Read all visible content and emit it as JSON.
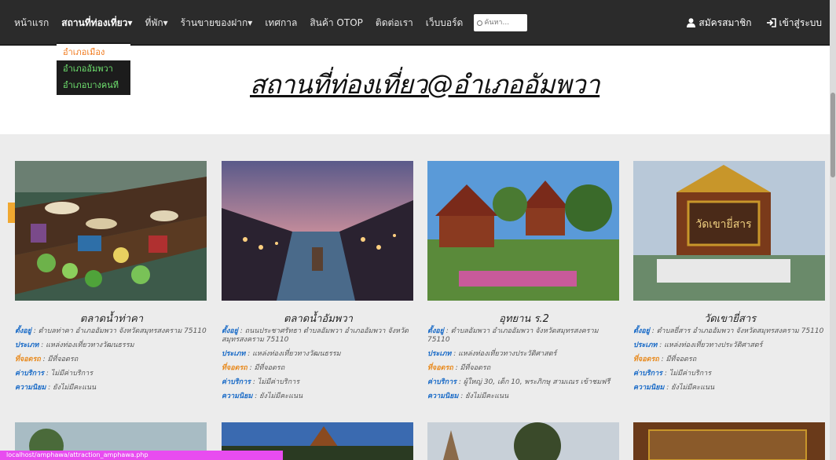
{
  "nav": {
    "items": [
      "หน้าแรก",
      "สถานที่ท่องเที่ยว▾",
      "ที่พัก▾",
      "ร้านขายของฝาก▾",
      "เทศกาล",
      "สินค้า OTOP",
      "ติดต่อเรา",
      "เว็บบอร์ด"
    ],
    "search_placeholder": "ค้นหา..."
  },
  "right_nav": {
    "register": "สมัครสมาชิก",
    "login": "เข้าสู่ระบบ"
  },
  "dropdown": [
    "อำเภอเมือง",
    "อำเภออัมพวา",
    "อำเภอบางคนที"
  ],
  "hero": {
    "title": "สถานที่ท่องเที่ยว@อำเภออัมพวา"
  },
  "info_icon": "i",
  "labels": {
    "address": "ตั้งอยู่",
    "type": "ประเภท",
    "contact": "ที่จอดรถ",
    "fee": "ค่าบริการ",
    "popularity": "ความนิยม"
  },
  "cards": [
    {
      "title": "ตลาดน้ำท่าคา",
      "address": " : ตำบลท่าคา อำเภออัมพวา จังหวัดสมุทรสงคราม 75110",
      "type": " : แหล่งท่องเที่ยวทางวัฒนธรรม",
      "contact": " : มีที่จอดรถ",
      "fee": " : ไม่มีค่าบริการ",
      "popularity": " : ยังไม่มีคะแนน"
    },
    {
      "title": "ตลาดน้ำอัมพวา",
      "address": " : ถนนประชาศรัทธา ตำบลอัมพวา อำเภออัมพวา จังหวัดสมุทรสงคราม 75110",
      "type": " : แหล่งท่องเที่ยวทางวัฒนธรรม",
      "contact": " : มีที่จอดรถ",
      "fee": " : ไม่มีค่าบริการ",
      "popularity": " : ยังไม่มีคะแนน"
    },
    {
      "title": "อุทยาน ร.2",
      "address": " : ตำบลอัมพวา อำเภออัมพวา จังหวัดสมุทรสงคราม 75110",
      "type": " : แหล่งท่องเที่ยวทางประวัติศาสตร์",
      "contact": " : มีที่จอดรถ",
      "fee": " : ผู้ใหญ่ 30, เด็ก 10, พระภิกษุ สามเณร เข้าชมฟรี",
      "popularity": " : ยังไม่มีคะแนน"
    },
    {
      "title": "วัดเขายี่สาร",
      "address": " : ตำบลยี่สาร อำเภออัมพวา จังหวัดสมุทรสงคราม 75110",
      "type": " : แหล่งท่องเที่ยวทางประวัติศาสตร์",
      "contact": " : มีที่จอดรถ",
      "fee": " : ไม่มีค่าบริการ",
      "popularity": " : ยังไม่มีคะแนน"
    }
  ],
  "sign_text": "วัดเขายี่สาร",
  "footer_url": "localhost/amphawa/attraction_amphawa.php"
}
